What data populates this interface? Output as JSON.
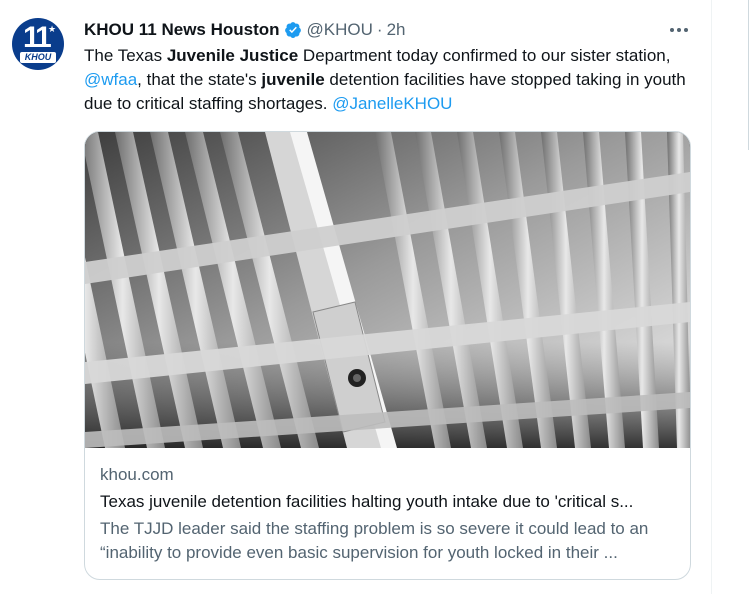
{
  "account": {
    "avatar_number": "11",
    "avatar_brand": "KHOU",
    "display_name": "KHOU 11 News Houston",
    "handle": "@KHOU",
    "separator": "·",
    "time": "2h",
    "verified_icon": "verified-badge-icon"
  },
  "tweet": {
    "text_parts": [
      {
        "text": "The Texas ",
        "style": "plain"
      },
      {
        "text": "Juvenile Justice",
        "style": "bold"
      },
      {
        "text": " Department today confirmed to our sister station, ",
        "style": "plain"
      },
      {
        "text": "@wfaa",
        "style": "link"
      },
      {
        "text": ", that the state's ",
        "style": "plain"
      },
      {
        "text": "juvenile",
        "style": "bold"
      },
      {
        "text": " detention facilities have stopped taking in youth due to critical staffing shortages. ",
        "style": "plain"
      },
      {
        "text": "@JanelleKHOU",
        "style": "link"
      }
    ]
  },
  "card": {
    "image_description_icon": "jail-cell-bars-image",
    "domain": "khou.com",
    "title": "Texas juvenile detention facilities halting youth intake due to 'critical s...",
    "description_line1": "The TJJD leader said the staffing problem is so severe it could lead to an",
    "description_line2": "“inability to provide even basic supervision for youth locked in their ..."
  },
  "colors": {
    "accent_link": "#1d9bf0",
    "primary_text": "#0f1419",
    "secondary_text": "#536471",
    "border": "#cfd9de",
    "verified": "#1d9bf0"
  }
}
